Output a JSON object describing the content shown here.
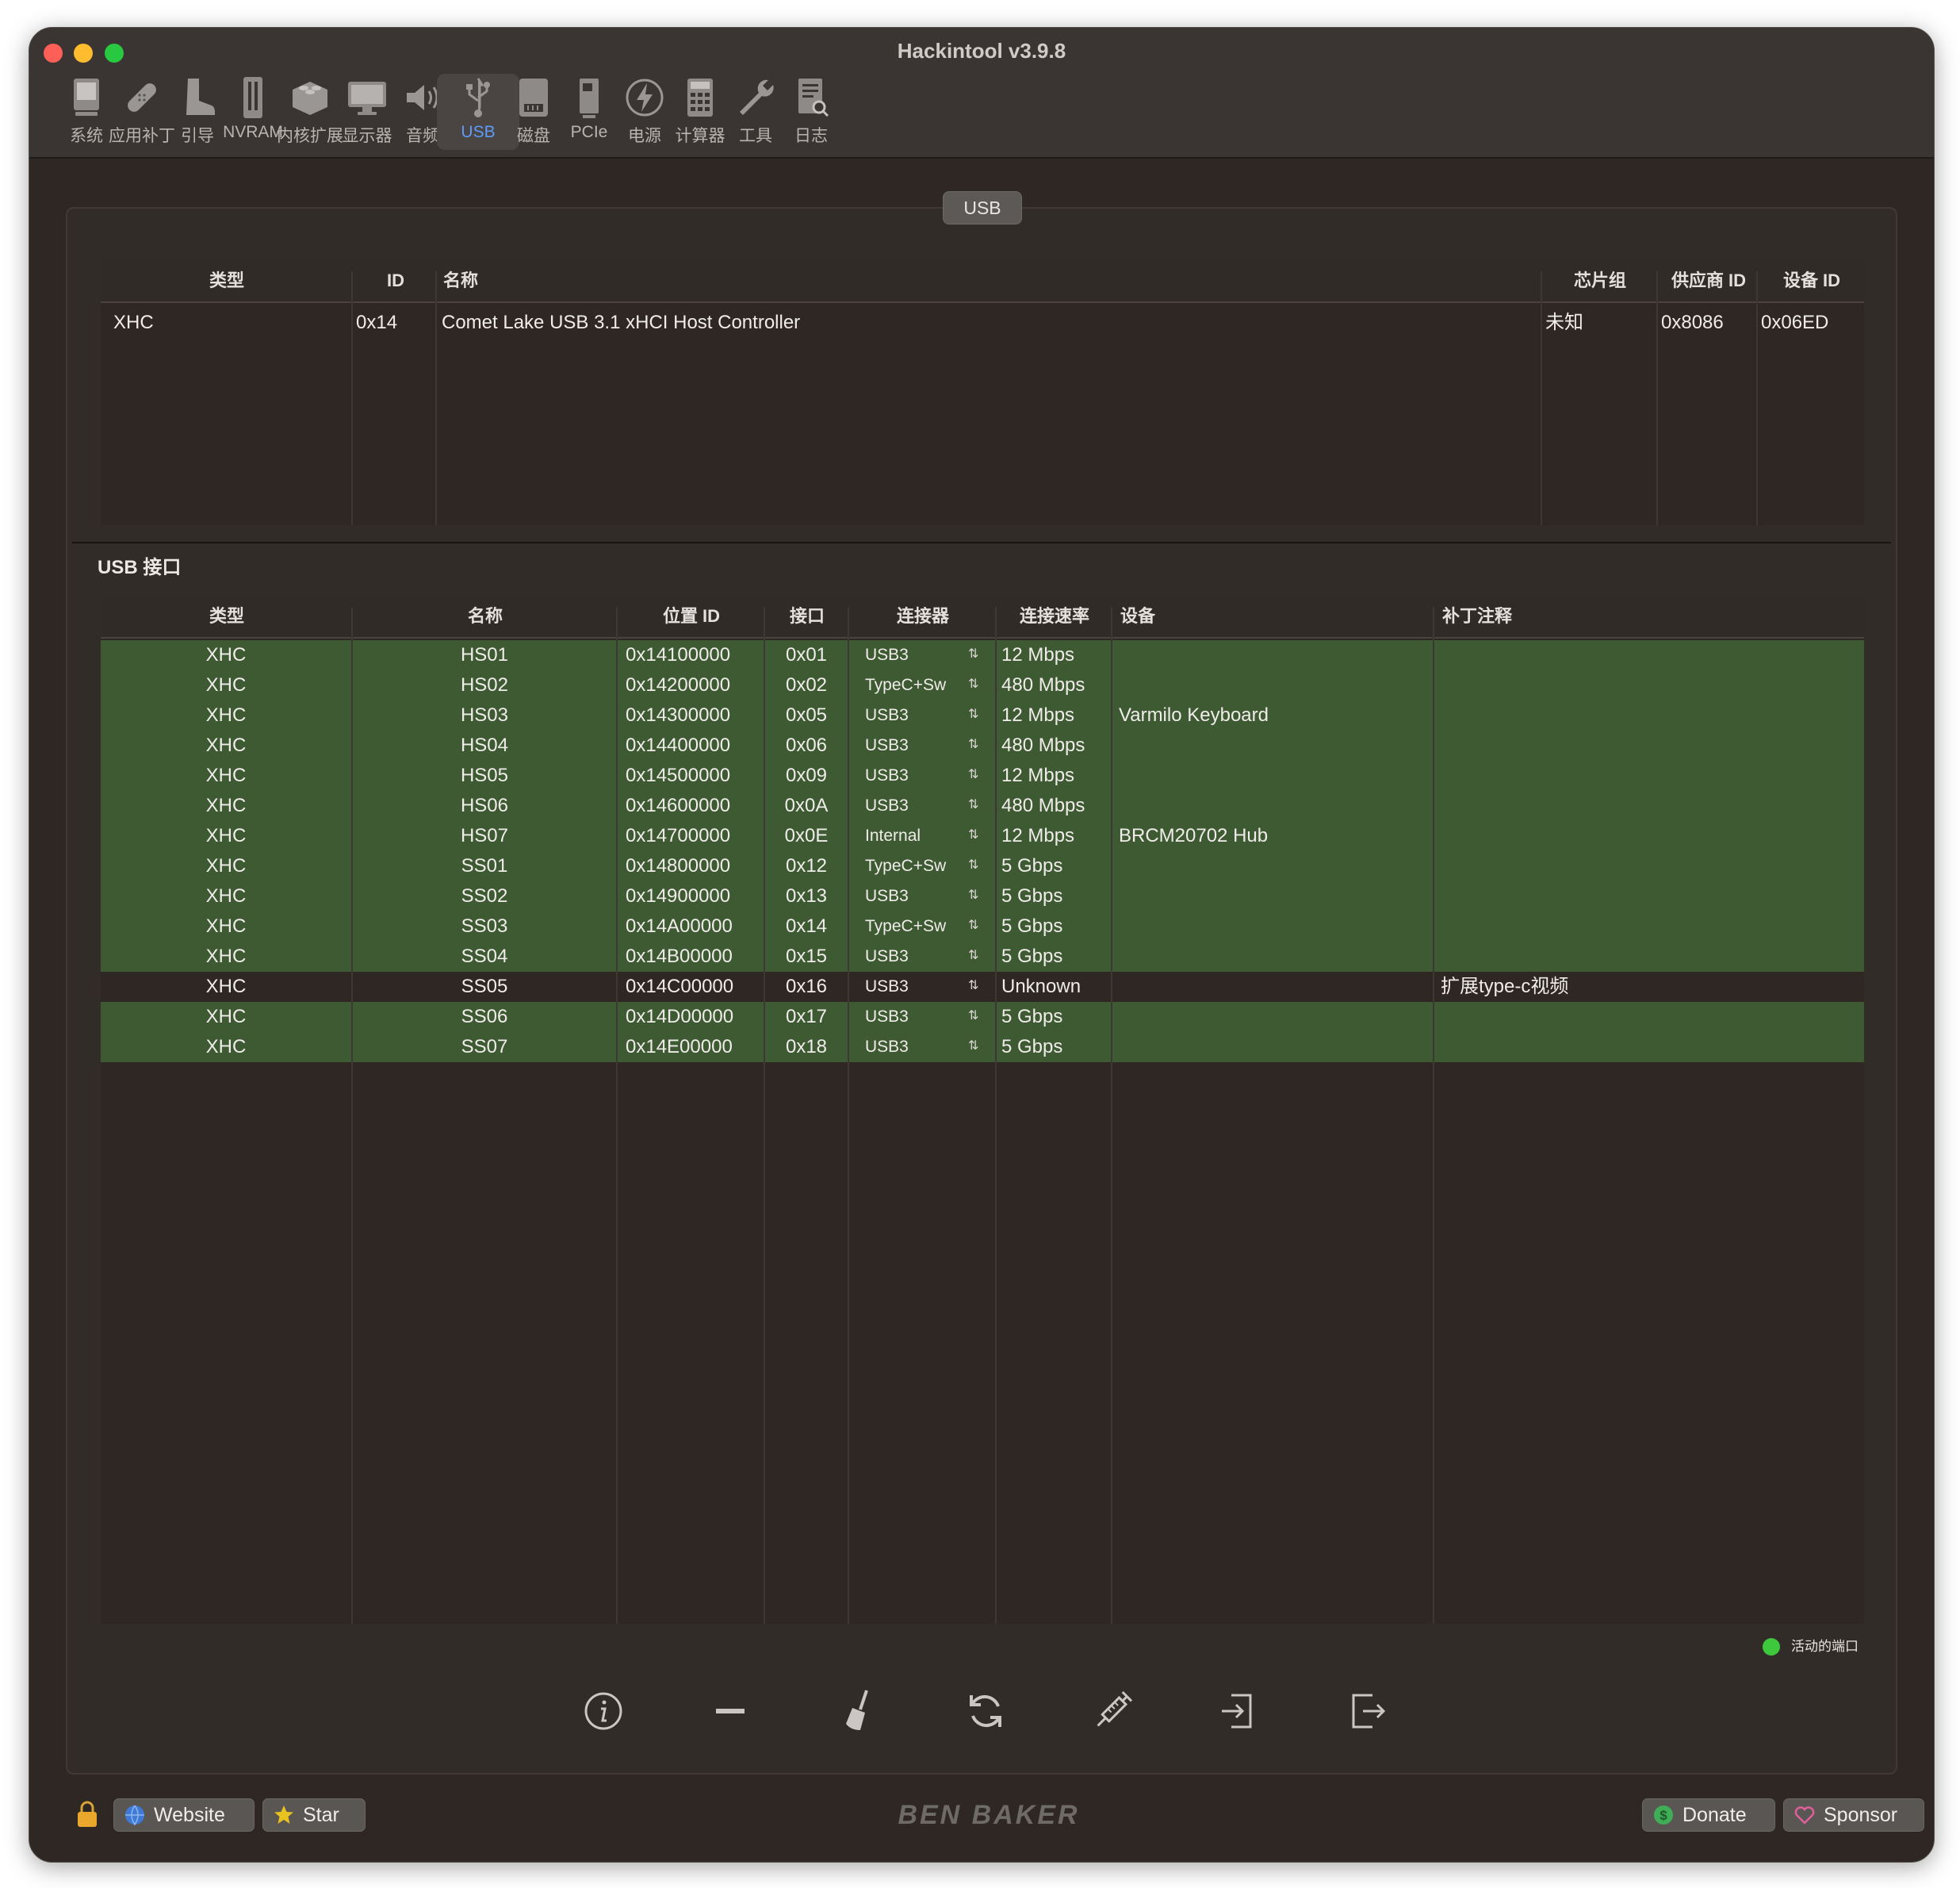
{
  "window": {
    "title": "Hackintool v3.9.8"
  },
  "toolbar": {
    "items": [
      {
        "label": "系统",
        "icon": "computer-icon"
      },
      {
        "label": "应用补丁",
        "icon": "bandage-icon"
      },
      {
        "label": "引导",
        "icon": "boot-icon"
      },
      {
        "label": "NVRAM",
        "icon": "memory-icon"
      },
      {
        "label": "内核扩展",
        "icon": "lego-brick-icon"
      },
      {
        "label": "显示器",
        "icon": "display-icon"
      },
      {
        "label": "音频",
        "icon": "speaker-icon"
      },
      {
        "label": "USB",
        "icon": "usb-icon"
      },
      {
        "label": "磁盘",
        "icon": "disk-icon"
      },
      {
        "label": "PCIe",
        "icon": "pcie-card-icon"
      },
      {
        "label": "电源",
        "icon": "power-bolt-icon"
      },
      {
        "label": "计算器",
        "icon": "calculator-icon"
      },
      {
        "label": "工具",
        "icon": "wrench-icon"
      },
      {
        "label": "日志",
        "icon": "log-document-icon"
      }
    ],
    "active_label": "USB"
  },
  "group": {
    "tab_label": "USB"
  },
  "controllers": {
    "headers": {
      "type": "类型",
      "id": "ID",
      "name": "名称",
      "chipset": "芯片组",
      "vendor_id": "供应商 ID",
      "device_id": "设备 ID"
    },
    "rows": [
      {
        "type": "XHC",
        "id": "0x14",
        "name": "Comet Lake USB 3.1 xHCI Host Controller",
        "chipset": "未知",
        "vendor_id": "0x8086",
        "device_id": "0x06ED"
      }
    ]
  },
  "ports_section": {
    "title": "USB 接口"
  },
  "ports": {
    "headers": {
      "type": "类型",
      "name": "名称",
      "location_id": "位置 ID",
      "port": "接口",
      "connector": "连接器",
      "speed": "连接速率",
      "device": "设备",
      "comment": "补丁注释"
    },
    "rows": [
      {
        "type": "XHC",
        "name": "HS01",
        "location_id": "0x14100000",
        "port": "0x01",
        "connector": "USB3",
        "speed": "12 Mbps",
        "device": "",
        "comment": "",
        "active": true
      },
      {
        "type": "XHC",
        "name": "HS02",
        "location_id": "0x14200000",
        "port": "0x02",
        "connector": "TypeC+Sw",
        "speed": "480 Mbps",
        "device": "",
        "comment": "",
        "active": true
      },
      {
        "type": "XHC",
        "name": "HS03",
        "location_id": "0x14300000",
        "port": "0x05",
        "connector": "USB3",
        "speed": "12 Mbps",
        "device": "Varmilo Keyboard",
        "comment": "",
        "active": true
      },
      {
        "type": "XHC",
        "name": "HS04",
        "location_id": "0x14400000",
        "port": "0x06",
        "connector": "USB3",
        "speed": "480 Mbps",
        "device": "",
        "comment": "",
        "active": true
      },
      {
        "type": "XHC",
        "name": "HS05",
        "location_id": "0x14500000",
        "port": "0x09",
        "connector": "USB3",
        "speed": "12 Mbps",
        "device": "",
        "comment": "",
        "active": true
      },
      {
        "type": "XHC",
        "name": "HS06",
        "location_id": "0x14600000",
        "port": "0x0A",
        "connector": "USB3",
        "speed": "480 Mbps",
        "device": "",
        "comment": "",
        "active": true
      },
      {
        "type": "XHC",
        "name": "HS07",
        "location_id": "0x14700000",
        "port": "0x0E",
        "connector": "Internal",
        "speed": "12 Mbps",
        "device": "BRCM20702 Hub",
        "comment": "",
        "active": true
      },
      {
        "type": "XHC",
        "name": "SS01",
        "location_id": "0x14800000",
        "port": "0x12",
        "connector": "TypeC+Sw",
        "speed": "5 Gbps",
        "device": "",
        "comment": "",
        "active": true
      },
      {
        "type": "XHC",
        "name": "SS02",
        "location_id": "0x14900000",
        "port": "0x13",
        "connector": "USB3",
        "speed": "5 Gbps",
        "device": "",
        "comment": "",
        "active": true
      },
      {
        "type": "XHC",
        "name": "SS03",
        "location_id": "0x14A00000",
        "port": "0x14",
        "connector": "TypeC+Sw",
        "speed": "5 Gbps",
        "device": "",
        "comment": "",
        "active": true
      },
      {
        "type": "XHC",
        "name": "SS04",
        "location_id": "0x14B00000",
        "port": "0x15",
        "connector": "USB3",
        "speed": "5 Gbps",
        "device": "",
        "comment": "",
        "active": true
      },
      {
        "type": "XHC",
        "name": "SS05",
        "location_id": "0x14C00000",
        "port": "0x16",
        "connector": "USB3",
        "speed": "Unknown",
        "device": "",
        "comment": "扩展type-c视频",
        "active": false
      },
      {
        "type": "XHC",
        "name": "SS06",
        "location_id": "0x14D00000",
        "port": "0x17",
        "connector": "USB3",
        "speed": "5 Gbps",
        "device": "",
        "comment": "",
        "active": true
      },
      {
        "type": "XHC",
        "name": "SS07",
        "location_id": "0x14E00000",
        "port": "0x18",
        "connector": "USB3",
        "speed": "5 Gbps",
        "device": "",
        "comment": "",
        "active": true
      }
    ]
  },
  "legend": {
    "label": "活动的端口"
  },
  "actions": [
    {
      "name": "info-button",
      "icon": "info-icon"
    },
    {
      "name": "remove-button",
      "icon": "minus-icon"
    },
    {
      "name": "clear-button",
      "icon": "broom-icon"
    },
    {
      "name": "refresh-button",
      "icon": "refresh-icon"
    },
    {
      "name": "inject-button",
      "icon": "syringe-icon"
    },
    {
      "name": "import-button",
      "icon": "import-icon"
    },
    {
      "name": "export-button",
      "icon": "export-icon"
    }
  ],
  "footer": {
    "website_label": "Website",
    "star_label": "Star",
    "brand": "BEN BAKER",
    "donate_label": "Donate",
    "sponsor_label": "Sponsor"
  },
  "colors": {
    "active_row": "#3e5a32",
    "inactive_row": "#2e2724",
    "active_tool": "#5c9cf5",
    "legend_dot": "#3ec83e"
  }
}
